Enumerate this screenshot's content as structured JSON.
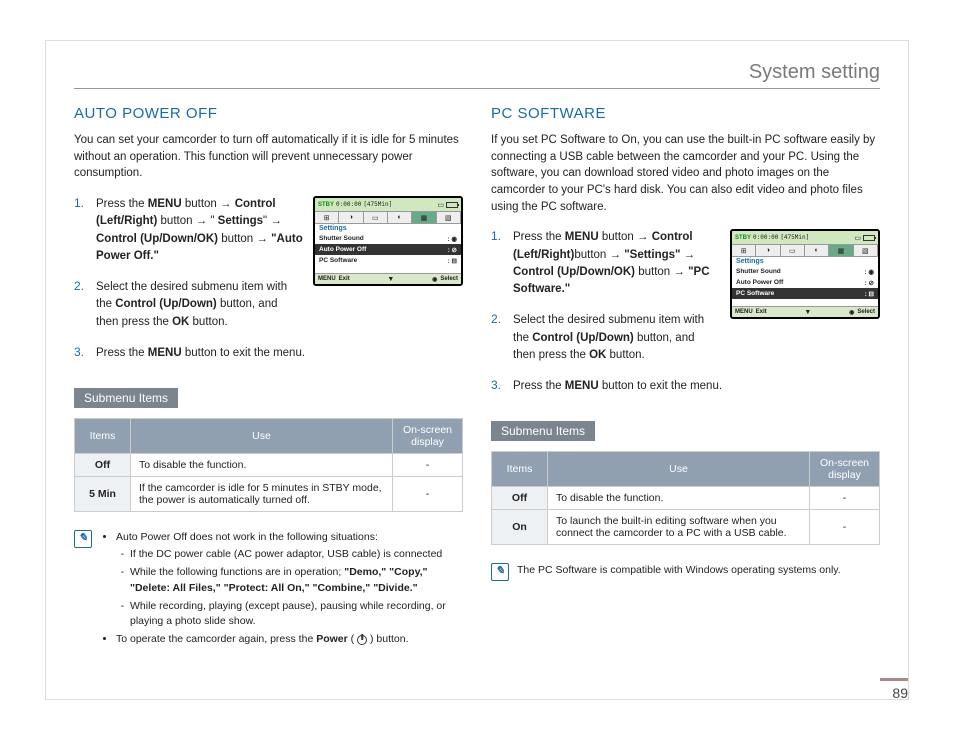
{
  "header": {
    "title": "System setting"
  },
  "page_number": "89",
  "left": {
    "title": "AUTO POWER OFF",
    "intro": "You can set your camcorder to turn off automatically if it is idle for 5 minutes without an operation. This function will prevent unnecessary power consumption.",
    "steps": [
      {
        "num": "1.",
        "parts": [
          "Press the ",
          "MENU",
          " button → ",
          "Control (Left/Right)",
          " button → \" ",
          "Settings",
          "\" → ",
          "Control (Up/Down/OK)",
          " button → ",
          "\"Auto Power Off.\""
        ]
      },
      {
        "num": "2.",
        "parts": [
          "Select the desired submenu item with the ",
          "Control (Up/Down)",
          " button, and then press the ",
          "OK",
          " button."
        ]
      },
      {
        "num": "3.",
        "parts": [
          "Press the ",
          "MENU",
          " button to exit the menu."
        ]
      }
    ],
    "submenu_heading": "Submenu Items",
    "table": {
      "headers": [
        "Items",
        "Use",
        "On-screen display"
      ],
      "rows": [
        {
          "item": "Off",
          "use": "To disable the function.",
          "osd": "-"
        },
        {
          "item": "5 Min",
          "use": "If the camcorder is idle for 5 minutes in STBY mode, the power is automatically turned off.",
          "osd": "-"
        }
      ]
    },
    "note": {
      "bullets": [
        {
          "text": "Auto Power Off does not work in the following situations:",
          "subs": [
            "If the DC power cable (AC power adaptor, USB cable) is connected",
            "While the following functions are in operation; \"Demo,\" \"Copy,\" \"Delete: All Files,\" \"Protect: All On,\" \"Combine,\" \"Divide.\"",
            "While recording, playing (except pause), pausing while recording, or playing a photo slide show."
          ]
        },
        {
          "text_pre": "To operate the camcorder again, press the ",
          "bold": "Power",
          "text_post": " ( ",
          "icon": "power-icon",
          "text_end": " ) button."
        }
      ]
    },
    "screenshot": {
      "stby": "STBY",
      "time": "0:00:00",
      "remain": "[475Min]",
      "settings": "Settings",
      "items": [
        "Shutter Sound",
        "Auto Power Off",
        "PC Software"
      ],
      "selected": 1,
      "menu": "MENU",
      "exit": "Exit",
      "select": "Select"
    }
  },
  "right": {
    "title": "PC SOFTWARE",
    "intro": "If you set PC Software to On, you can use the built-in PC software easily by connecting a USB cable between the camcorder and your PC. Using the software, you can download stored video and photo images on the camcorder to your PC's hard disk. You can also edit video and photo files using the PC software.",
    "steps": [
      {
        "num": "1.",
        "parts": [
          "Press the ",
          "MENU",
          " button → ",
          "Control (Left/Right)",
          "button → ",
          "\"Settings\"",
          " → ",
          "Control (Up/Down/OK)",
          " button → ",
          "\"PC Software.\""
        ]
      },
      {
        "num": "2.",
        "parts": [
          "Select the desired submenu item with the ",
          "Control (Up/Down)",
          " button, and then press the ",
          "OK",
          " button."
        ]
      },
      {
        "num": "3.",
        "parts": [
          "Press the ",
          "MENU",
          " button to exit the menu."
        ]
      }
    ],
    "submenu_heading": "Submenu Items",
    "table": {
      "headers": [
        "Items",
        "Use",
        "On-screen display"
      ],
      "rows": [
        {
          "item": "Off",
          "use": "To disable the function.",
          "osd": "-"
        },
        {
          "item": "On",
          "use": "To launch the built-in editing software when you connect the camcorder to a PC with a USB cable.",
          "osd": "-"
        }
      ]
    },
    "note": {
      "text": "The PC Software is compatible with Windows operating systems only."
    },
    "screenshot": {
      "stby": "STBY",
      "time": "0:00:00",
      "remain": "[475Min]",
      "settings": "Settings",
      "items": [
        "Shutter Sound",
        "Auto Power Off",
        "PC Software"
      ],
      "selected": 2,
      "menu": "MENU",
      "exit": "Exit",
      "select": "Select"
    }
  }
}
